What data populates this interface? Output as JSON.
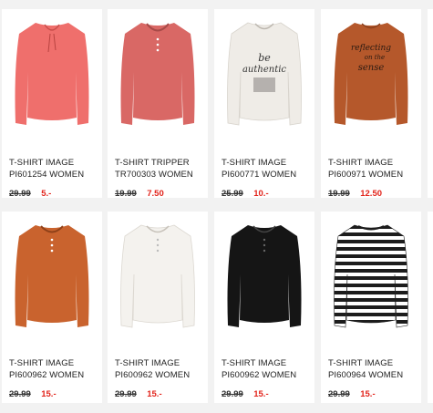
{
  "products": [
    {
      "line1": "T-SHIRT IMAGE",
      "line2": "PI601254 WOMEN",
      "old_price": "29.99",
      "new_price": "5.-",
      "color": "#ef6f6c",
      "icon": "t-shirt-coral-tie-neck",
      "print": ""
    },
    {
      "line1": "T-SHIRT TRIPPER",
      "line2": "TR700303 WOMEN",
      "old_price": "19.99",
      "new_price": "7.50",
      "color": "#d96865",
      "icon": "t-shirt-pink-henley",
      "print": ""
    },
    {
      "line1": "T-SHIRT IMAGE",
      "line2": "PI600771 WOMEN",
      "old_price": "25.99",
      "new_price": "10.-",
      "color": "#efece7",
      "icon": "t-shirt-white-print",
      "print": "be authentic"
    },
    {
      "line1": "T-SHIRT IMAGE",
      "line2": "PI600971 WOMEN",
      "old_price": "19.99",
      "new_price": "12.50",
      "color": "#b5582b",
      "icon": "t-shirt-rust-print",
      "print": "reflecting sense"
    },
    {
      "line1": "T-SHIRT IMAGE",
      "line2": "PI600962 WOMEN",
      "old_price": "29.99",
      "new_price": "15.-",
      "color": "#c9632e",
      "icon": "t-shirt-orange-henley",
      "print": ""
    },
    {
      "line1": "T-SHIRT IMAGE",
      "line2": "PI600962 WOMEN",
      "old_price": "29.99",
      "new_price": "15.-",
      "color": "#f4f2ee",
      "icon": "t-shirt-white-henley",
      "print": ""
    },
    {
      "line1": "T-SHIRT IMAGE",
      "line2": "PI600962 WOMEN",
      "old_price": "29.99",
      "new_price": "15.-",
      "color": "#151515",
      "icon": "t-shirt-black-henley",
      "print": ""
    },
    {
      "line1": "T-SHIRT IMAGE",
      "line2": "PI600964 WOMEN",
      "old_price": "29.99",
      "new_price": "15.-",
      "color": "#1c1c1c",
      "icon": "t-shirt-striped",
      "print": ""
    }
  ],
  "colors": {
    "sale_red": "#e2231a",
    "text": "#222222",
    "background": "#f2f2f2"
  }
}
